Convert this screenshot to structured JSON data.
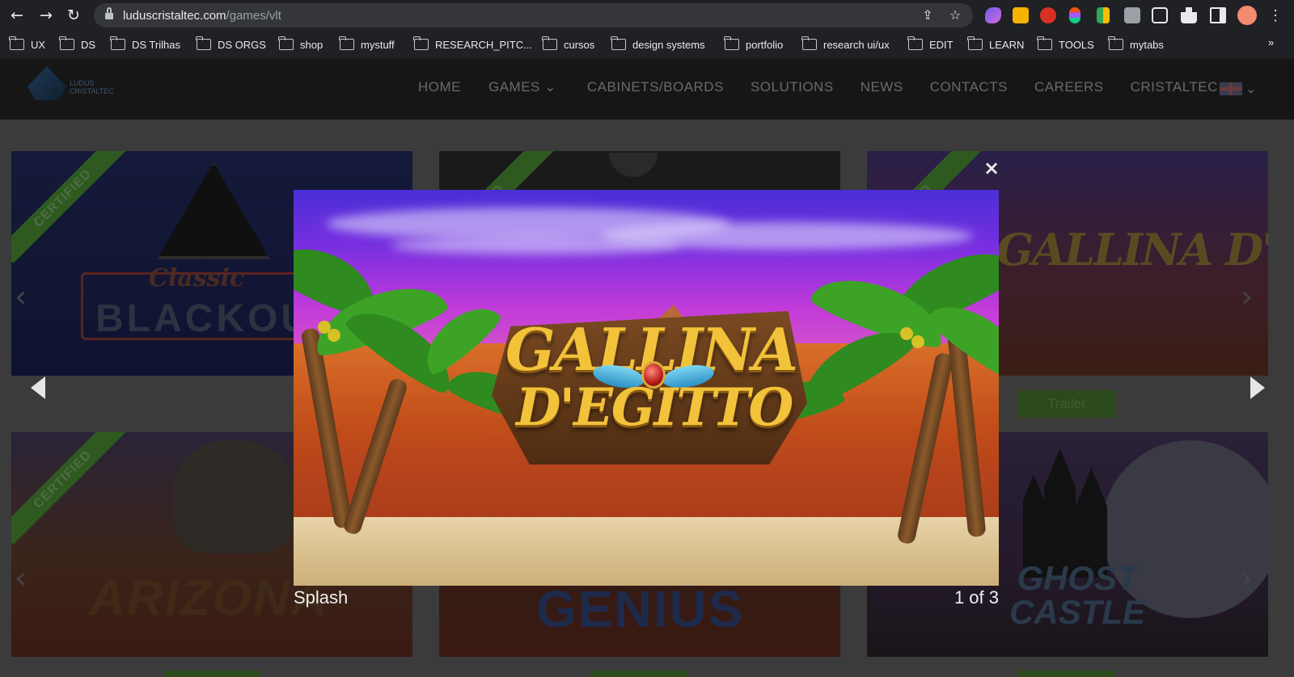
{
  "browser": {
    "url_domain": "luduscristaltec.com",
    "url_path": "/games/vlt",
    "back_glyph": "←",
    "forward_glyph": "→",
    "reload_glyph": "↻",
    "share_glyph": "⇪",
    "star_glyph": "☆",
    "more_glyph": "⋮",
    "bookmarks_overflow": "»",
    "bookmarks": [
      "UX",
      "DS",
      "DS Trilhas",
      "DS ORGS",
      "shop",
      "mystuff",
      "RESEARCH_PITC...",
      "cursos",
      "design systems",
      "portfolio",
      "research ui/ux",
      "EDIT",
      "LEARN",
      "TOOLS",
      "mytabs"
    ],
    "extensions": [
      {
        "name": "arc-extension-icon",
        "color": "#8b6cf0"
      },
      {
        "name": "notes-extension-icon",
        "color": "#f4b400"
      },
      {
        "name": "adblock-extension-icon",
        "color": "#d93025"
      },
      {
        "name": "figma-extension-icon",
        "color": "#a259ff"
      },
      {
        "name": "colors-extension-icon",
        "color": "#34a853"
      },
      {
        "name": "camera-extension-icon",
        "color": "#9aa0a6"
      },
      {
        "name": "notion-extension-icon",
        "color": "#e8eaed"
      },
      {
        "name": "puzzle-extension-icon",
        "color": "#e8eaed"
      },
      {
        "name": "sidepanel-icon",
        "color": "#e8eaed"
      }
    ],
    "profile_color": "#f28b6f"
  },
  "site": {
    "logo_text_1": "LUDUS",
    "logo_text_2": "CRISTALTEC",
    "nav": [
      "HOME",
      "GAMES",
      "CABINETS/BOARDS",
      "SOLUTIONS",
      "NEWS",
      "CONTACTS",
      "CAREERS",
      "CRISTALTEC"
    ],
    "games_dropdown_glyph": "⌄",
    "lang_dropdown_glyph": "⌄",
    "ribbon_text": "CERTIFIED",
    "ribbon_partial_text": "FIED",
    "tiles": [
      {
        "title": "BLACKOUT",
        "subtitle": "Classic"
      },
      {
        "title": "",
        "subtitle": ""
      },
      {
        "title": "GALLINA D'EGITTO",
        "subtitle": ""
      },
      {
        "title": "ARIZONA",
        "subtitle": ""
      },
      {
        "title": "GENIUS",
        "subtitle": ""
      },
      {
        "title": "GHOST CASTLE",
        "subtitle": ""
      }
    ],
    "trailer_label": "Trailer",
    "tile_arrow_left": "‹",
    "tile_arrow_right": "›"
  },
  "lightbox": {
    "close_glyph": "×",
    "caption": "Splash",
    "counter": "1 of 3",
    "image_title_line1": "GALLINA",
    "image_title_line2": "D'EGITTO"
  }
}
